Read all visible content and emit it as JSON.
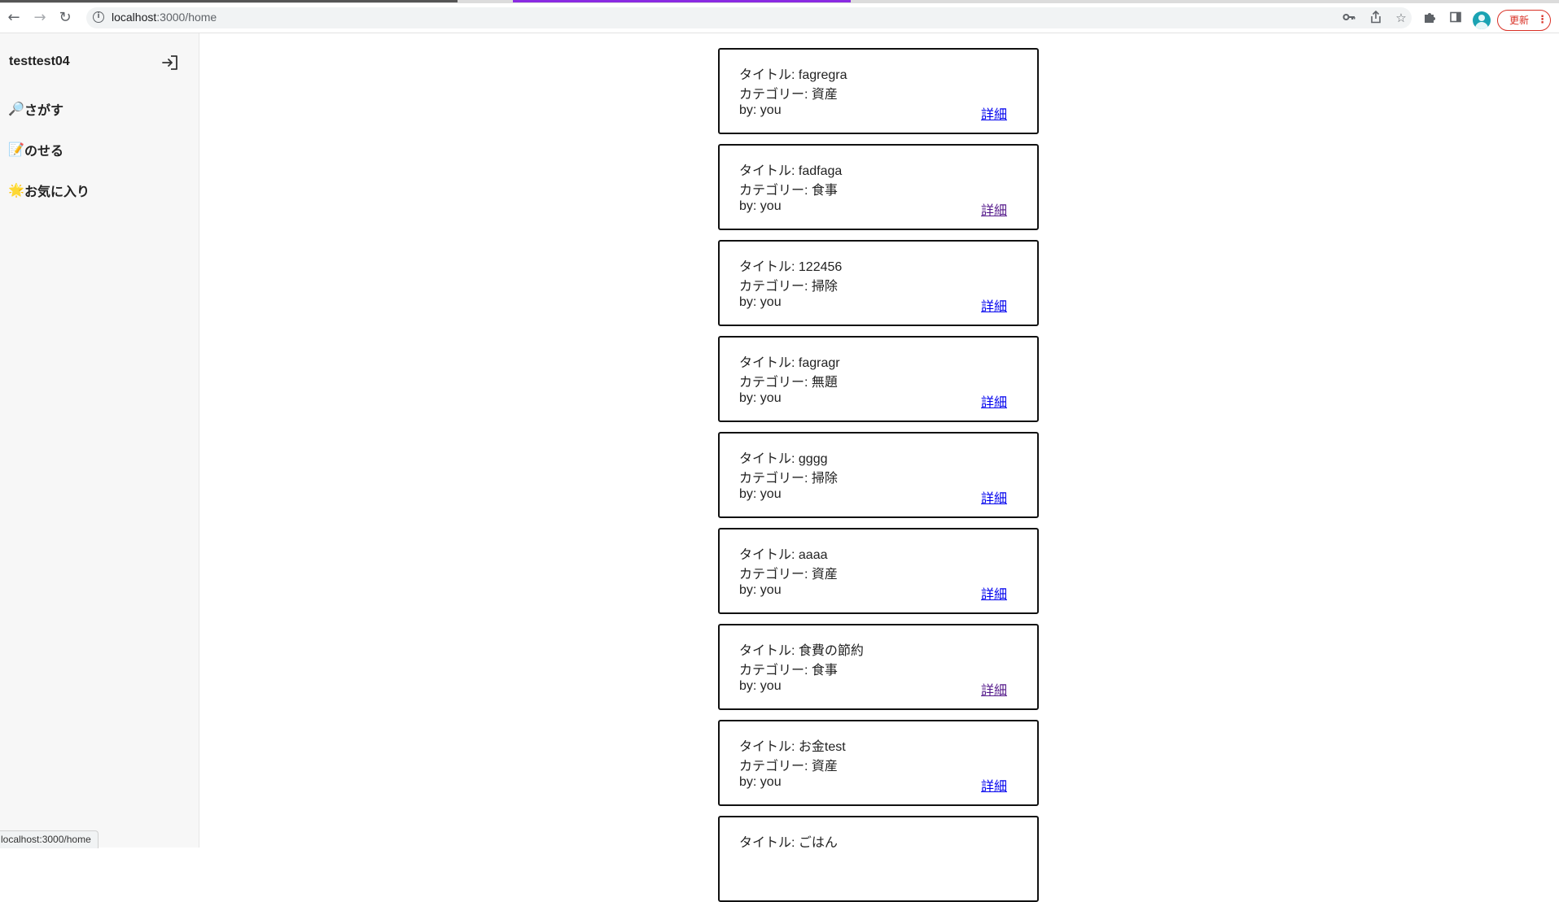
{
  "browser": {
    "url_host": "localhost",
    "url_path": ":3000/home",
    "update_label": "更新",
    "update_menu": "⋮",
    "status_url": "localhost:3000/home"
  },
  "sidebar": {
    "user_name": "testtest04",
    "items": [
      {
        "icon": "🔎",
        "label": "さがす"
      },
      {
        "icon": "📝",
        "label": "のせる"
      },
      {
        "icon": "🌟",
        "label": "お気に入り"
      }
    ]
  },
  "cards": [
    {
      "title": "タイトル: fagregra",
      "category": "カテゴリー: 資産",
      "author": "by: you",
      "detail": "詳細",
      "visited": false
    },
    {
      "title": "タイトル: fadfaga",
      "category": "カテゴリー: 食事",
      "author": "by: you",
      "detail": "詳細",
      "visited": true
    },
    {
      "title": "タイトル: 122456",
      "category": "カテゴリー: 掃除",
      "author": "by: you",
      "detail": "詳細",
      "visited": false
    },
    {
      "title": "タイトル: fagragr",
      "category": "カテゴリー: 無題",
      "author": "by: you",
      "detail": "詳細",
      "visited": false
    },
    {
      "title": "タイトル: gggg",
      "category": "カテゴリー: 掃除",
      "author": "by: you",
      "detail": "詳細",
      "visited": false
    },
    {
      "title": "タイトル: aaaa",
      "category": "カテゴリー: 資産",
      "author": "by: you",
      "detail": "詳細",
      "visited": false
    },
    {
      "title": "タイトル: 食費の節約",
      "category": "カテゴリー: 食事",
      "author": "by: you",
      "detail": "詳細",
      "visited": true
    },
    {
      "title": "タイトル: お金test",
      "category": "カテゴリー: 資産",
      "author": "by: you",
      "detail": "詳細",
      "visited": false
    },
    {
      "title": "タイトル: ごはん",
      "category": "",
      "author": "",
      "detail": "",
      "visited": false
    }
  ]
}
